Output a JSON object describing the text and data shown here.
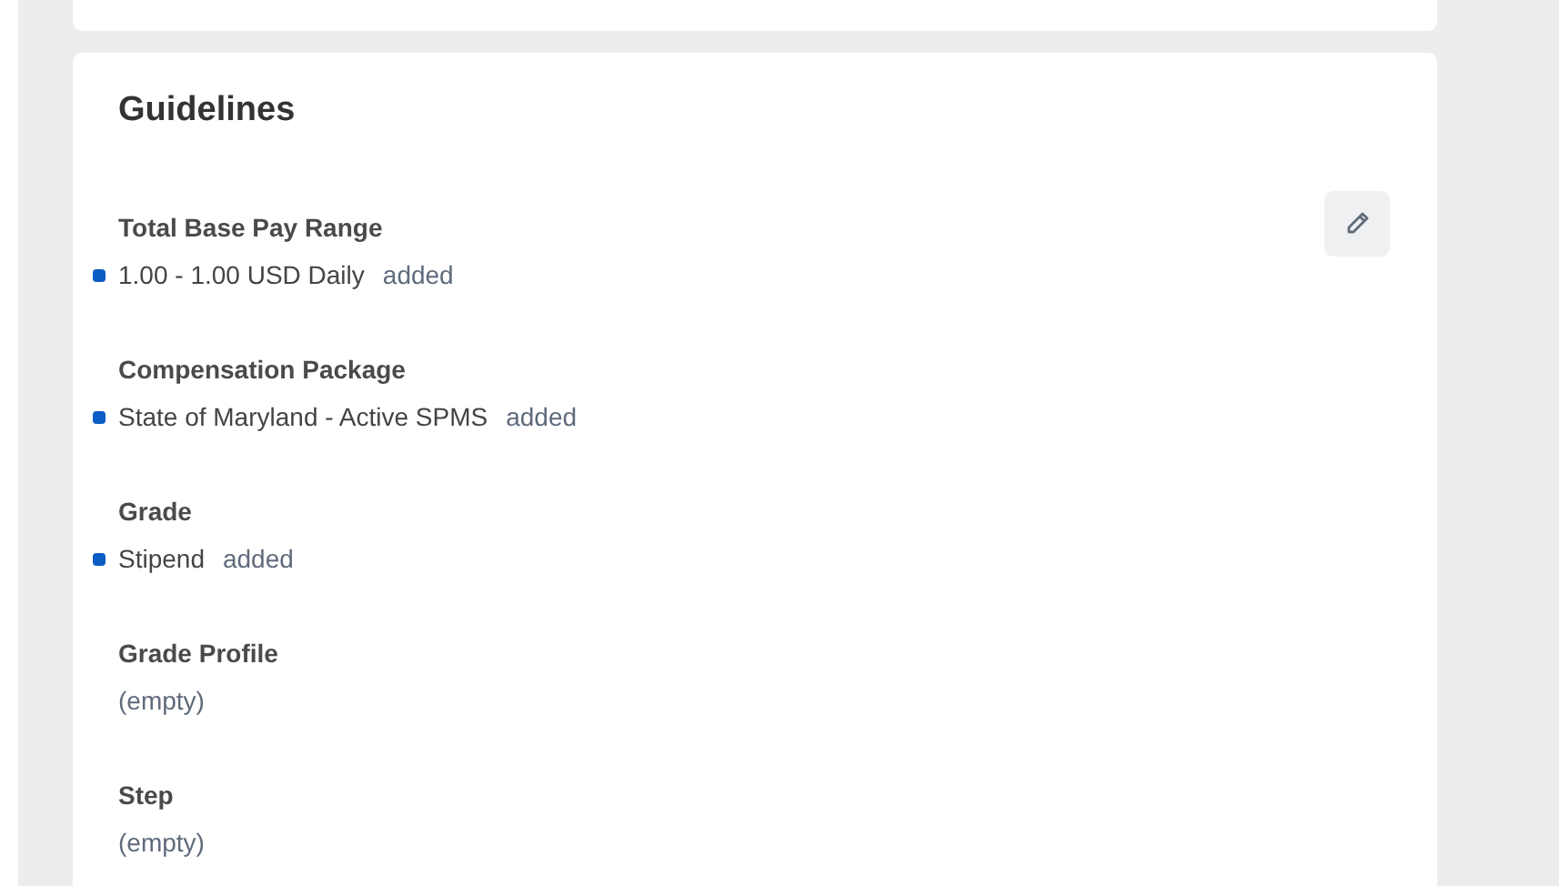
{
  "card": {
    "title": "Guidelines"
  },
  "fields": [
    {
      "label": "Total Base Pay Range",
      "kind": "changed",
      "value": "1.00 - 1.00 USD Daily",
      "change": "added"
    },
    {
      "label": "Compensation Package",
      "kind": "changed",
      "value": "State of Maryland - Active SPMS",
      "change": "added"
    },
    {
      "label": "Grade",
      "kind": "changed",
      "value": "Stipend",
      "change": "added"
    },
    {
      "label": "Grade Profile",
      "kind": "empty",
      "value": "(empty)"
    },
    {
      "label": "Step",
      "kind": "empty",
      "value": "(empty)"
    }
  ]
}
